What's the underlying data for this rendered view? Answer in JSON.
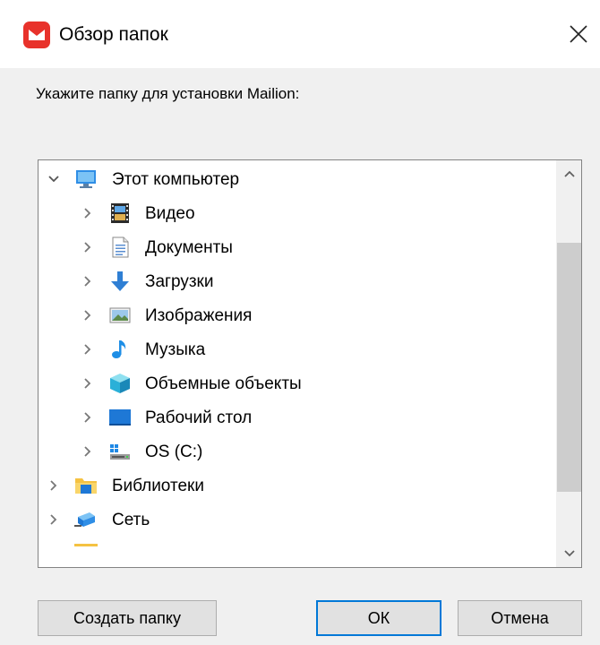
{
  "window": {
    "title": "Обзор папок",
    "app_icon": "mailion-envelope-icon",
    "accent_color": "#e8322b"
  },
  "prompt": "Укажите папку для установки Mailion:",
  "tree": {
    "items": [
      {
        "label": "Этот компьютер",
        "icon": "computer-icon",
        "level": 0,
        "expanded": true
      },
      {
        "label": "Видео",
        "icon": "video-folder-icon",
        "level": 1,
        "expanded": false
      },
      {
        "label": "Документы",
        "icon": "documents-folder-icon",
        "level": 1,
        "expanded": false
      },
      {
        "label": "Загрузки",
        "icon": "downloads-folder-icon",
        "level": 1,
        "expanded": false
      },
      {
        "label": "Изображения",
        "icon": "pictures-folder-icon",
        "level": 1,
        "expanded": false
      },
      {
        "label": "Музыка",
        "icon": "music-folder-icon",
        "level": 1,
        "expanded": false
      },
      {
        "label": "Объемные объекты",
        "icon": "3d-objects-folder-icon",
        "level": 1,
        "expanded": false
      },
      {
        "label": "Рабочий стол",
        "icon": "desktop-folder-icon",
        "level": 1,
        "expanded": false
      },
      {
        "label": "OS (C:)",
        "icon": "drive-icon",
        "level": 1,
        "expanded": false
      },
      {
        "label": "Библиотеки",
        "icon": "libraries-folder-icon",
        "level": 0,
        "expanded": false
      },
      {
        "label": "Сеть",
        "icon": "network-icon",
        "level": 0,
        "expanded": false
      }
    ]
  },
  "buttons": {
    "new_folder": "Создать папку",
    "ok": "ОК",
    "cancel": "Отмена"
  }
}
